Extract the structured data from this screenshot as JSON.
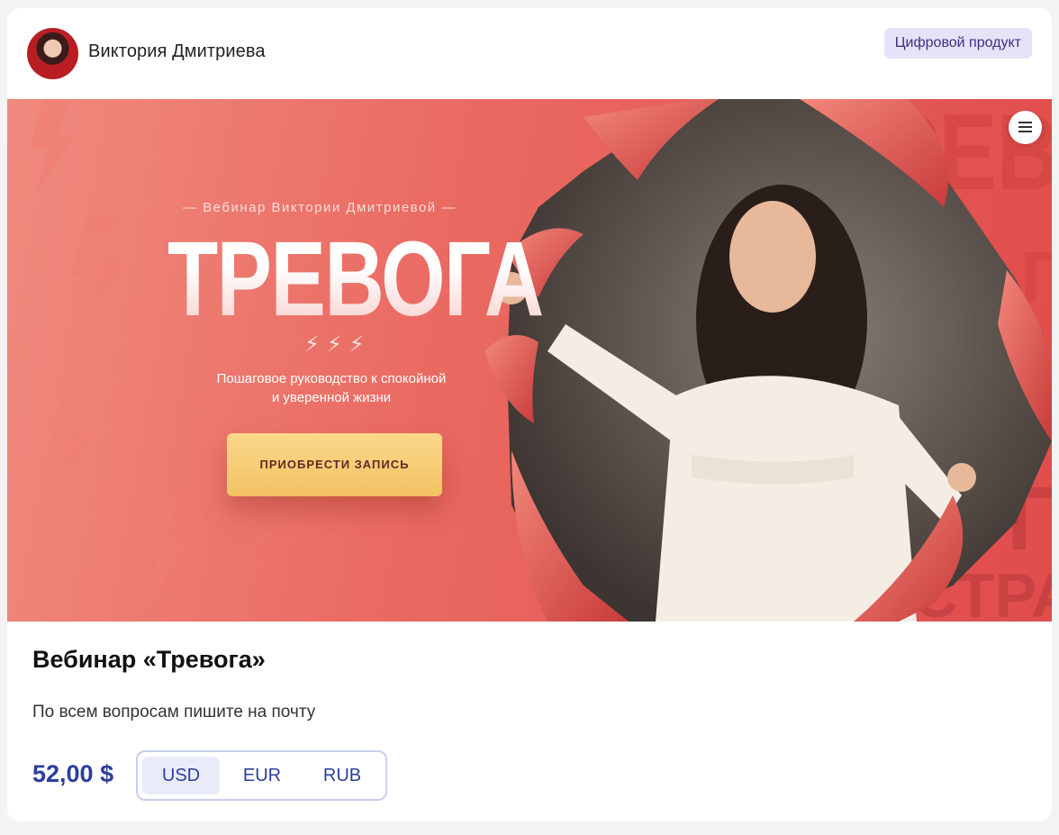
{
  "author": {
    "name": "Виктория Дмитриева"
  },
  "badge": "Цифровой продукт",
  "banner": {
    "subtitle": "— Вебинар Виктории Дмитриевой —",
    "title": "ТРЕВОГА",
    "bolts": "⚡⚡⚡",
    "tagline": "Пошаговое руководство к спокойной и уверенной жизни",
    "cta_label": "ПРИОБРЕСТИ ЗАПИСЬ",
    "bg_words": [
      "ТРЕВО",
      "П",
      "П",
      "СТРАХ"
    ]
  },
  "product": {
    "title": "Вебинар «Тревога»",
    "description": "По всем вопросам пишите на почту"
  },
  "pricing": {
    "price": "52,00 $",
    "currencies": [
      "USD",
      "EUR",
      "RUB"
    ],
    "selected": "USD"
  },
  "colors": {
    "accent": "#2b3f9c",
    "badge_bg": "#e6e2f7",
    "banner_red": "#e45a55",
    "cta_gold": "#f3c263"
  },
  "icons": {
    "menu": "hamburger-icon",
    "bolt": "lightning-icon"
  }
}
